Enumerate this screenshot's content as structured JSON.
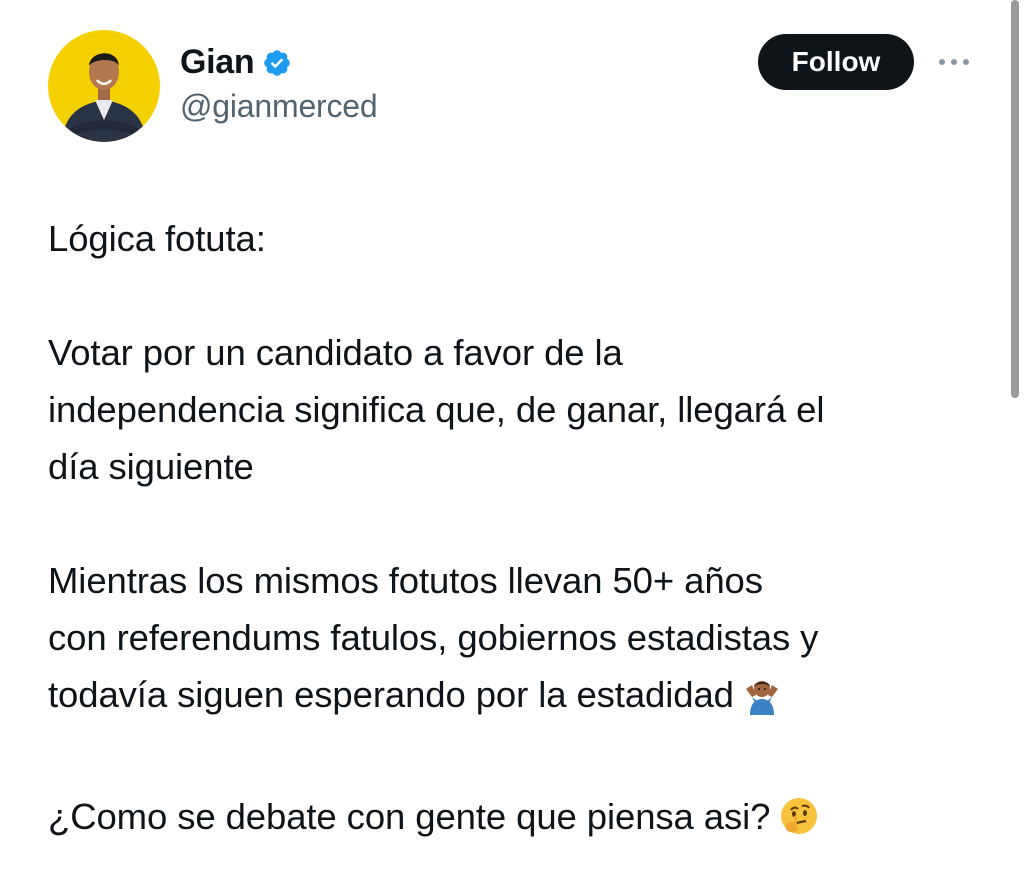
{
  "author": {
    "display_name": "Gian",
    "handle": "@gianmerced",
    "verified": true,
    "verified_color": "#1d9bf0",
    "avatar_bg": "#f5d000"
  },
  "actions": {
    "follow_label": "Follow",
    "more_icon": "more-horizontal-icon"
  },
  "tweet": {
    "paragraphs": [
      {
        "lines": [
          "Lógica fotuta:"
        ]
      },
      {
        "lines": [
          "Votar por un candidato a favor de la",
          "independencia significa que, de ganar, llegará el",
          "día siguiente"
        ]
      },
      {
        "lines": [
          "Mientras los mismos fotutos llevan 50+ años",
          "con referendums fatulos, gobiernos estadistas y",
          "todavía siguen esperando por la estadidad"
        ],
        "emoji": "shrug-emoji"
      },
      {
        "lines": [
          "¿Como se debate con gente que piensa asi?"
        ],
        "emoji": "thinking-face-emoji"
      }
    ]
  },
  "colors": {
    "text": "#0f1419",
    "secondary_text": "#536471",
    "button_bg": "#0f1419"
  }
}
